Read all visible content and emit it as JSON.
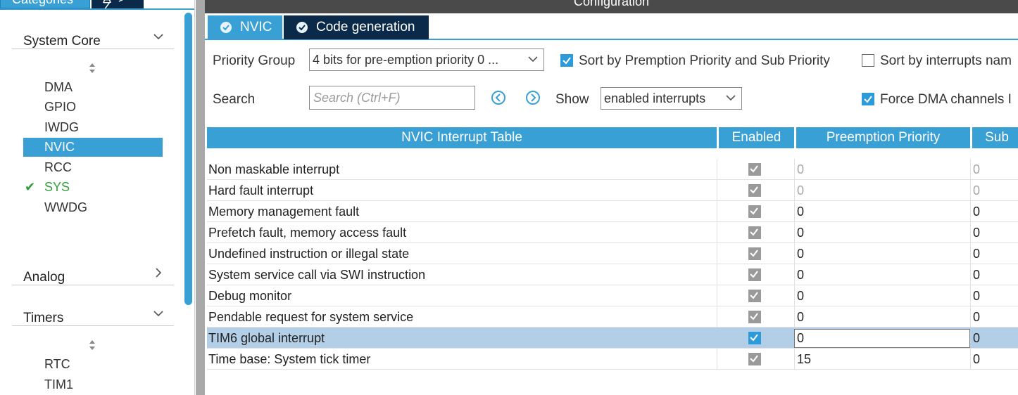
{
  "left_panel": {
    "tabs": {
      "categories": "Categories",
      "az": "A -> Z"
    },
    "groups": [
      {
        "label": "System Core",
        "expanded": true
      },
      {
        "label": "Analog",
        "expanded": false
      },
      {
        "label": "Timers",
        "expanded": true
      }
    ],
    "system_core_items": [
      {
        "label": "DMA",
        "state": "normal"
      },
      {
        "label": "GPIO",
        "state": "normal"
      },
      {
        "label": "IWDG",
        "state": "normal"
      },
      {
        "label": "NVIC",
        "state": "selected"
      },
      {
        "label": "RCC",
        "state": "normal"
      },
      {
        "label": "SYS",
        "state": "configured"
      },
      {
        "label": "WWDG",
        "state": "normal"
      }
    ],
    "timers_items": [
      {
        "label": "RTC"
      },
      {
        "label": "TIM1"
      }
    ]
  },
  "right_panel": {
    "title": "Configuration",
    "tabs": [
      {
        "label": "NVIC",
        "active": true
      },
      {
        "label": "Code generation",
        "active": false
      }
    ],
    "priority_group": {
      "label": "Priority Group",
      "value": "4 bits for pre-emption priority 0 ..."
    },
    "sort_premption": {
      "label": "Sort by Premption Priority and Sub Priority",
      "checked": true
    },
    "sort_name": {
      "label": "Sort by interrupts nam",
      "checked": false
    },
    "search": {
      "label": "Search",
      "placeholder": "Search (Ctrl+F)"
    },
    "show": {
      "label": "Show",
      "value": "enabled interrupts"
    },
    "force_dma": {
      "label": "Force DMA channels I",
      "checked": true
    },
    "table": {
      "headers": [
        "NVIC Interrupt Table",
        "Enabled",
        "Preemption Priority",
        "Sub"
      ],
      "rows": [
        {
          "name": "Non maskable interrupt",
          "enabled": true,
          "locked": true,
          "preemption": "0",
          "sub": "0",
          "muted": true
        },
        {
          "name": "Hard fault interrupt",
          "enabled": true,
          "locked": true,
          "preemption": "0",
          "sub": "0",
          "muted": true
        },
        {
          "name": "Memory management fault",
          "enabled": true,
          "locked": true,
          "preemption": "0",
          "sub": "0",
          "muted": false
        },
        {
          "name": "Prefetch fault, memory access fault",
          "enabled": true,
          "locked": true,
          "preemption": "0",
          "sub": "0",
          "muted": false
        },
        {
          "name": "Undefined instruction or illegal state",
          "enabled": true,
          "locked": true,
          "preemption": "0",
          "sub": "0",
          "muted": false
        },
        {
          "name": "System service call via SWI instruction",
          "enabled": true,
          "locked": true,
          "preemption": "0",
          "sub": "0",
          "muted": false
        },
        {
          "name": "Debug monitor",
          "enabled": true,
          "locked": true,
          "preemption": "0",
          "sub": "0",
          "muted": false
        },
        {
          "name": "Pendable request for system service",
          "enabled": true,
          "locked": true,
          "preemption": "0",
          "sub": "0",
          "muted": false
        },
        {
          "name": "TIM6 global interrupt",
          "enabled": true,
          "locked": false,
          "preemption": "0",
          "sub": "0",
          "muted": false,
          "selected": true
        },
        {
          "name": "Time base: System tick timer",
          "enabled": true,
          "locked": true,
          "preemption": "15",
          "sub": "0",
          "muted": false
        }
      ]
    }
  },
  "colors": {
    "accent": "#39a0d6",
    "dark_tab": "#0b2a4a",
    "selected_row": "#b3cfe8",
    "ok_green": "#2f9e3a"
  }
}
